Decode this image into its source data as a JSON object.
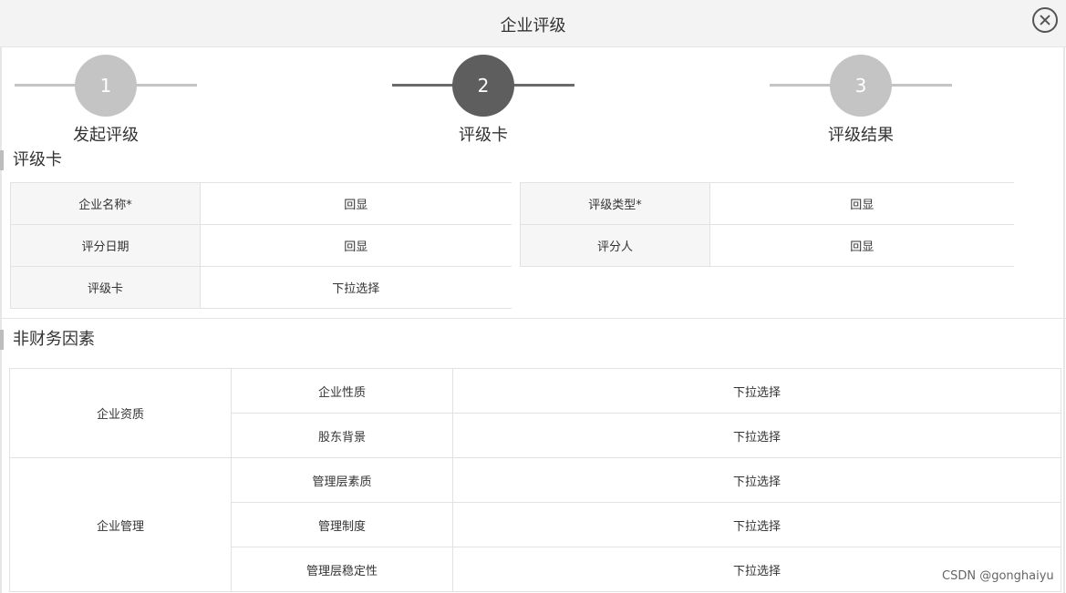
{
  "dialog": {
    "title": "企业评级",
    "close_icon": "close-icon"
  },
  "steps": [
    {
      "number": "1",
      "label": "发起评级",
      "state": "inactive"
    },
    {
      "number": "2",
      "label": "评级卡",
      "state": "active"
    },
    {
      "number": "3",
      "label": "评级结果",
      "state": "inactive"
    }
  ],
  "rating_card": {
    "section_title": "评级卡",
    "left": [
      {
        "label": "企业名称*",
        "value": "回显"
      },
      {
        "label": "评分日期",
        "value": "回显"
      },
      {
        "label": "评级卡",
        "value": "下拉选择"
      }
    ],
    "right": [
      {
        "label": "评级类型*",
        "value": "回显"
      },
      {
        "label": "评分人",
        "value": "回显"
      }
    ]
  },
  "non_financial": {
    "section_title": "非财务因素",
    "groups": [
      {
        "name": "企业资质",
        "items": [
          {
            "factor": "企业性质",
            "value": "下拉选择"
          },
          {
            "factor": "股东背景",
            "value": "下拉选择"
          }
        ]
      },
      {
        "name": "企业管理",
        "items": [
          {
            "factor": "管理层素质",
            "value": "下拉选择"
          },
          {
            "factor": "管理制度",
            "value": "下拉选择"
          },
          {
            "factor": "管理层稳定性",
            "value": "下拉选择"
          }
        ]
      }
    ]
  },
  "watermark": "CSDN @gonghaiyu",
  "colors": {
    "active_step": "#5e5e5e",
    "inactive_step": "#c4c4c4",
    "label_bg": "#f6f6f6",
    "border": "#e2e2e2"
  }
}
